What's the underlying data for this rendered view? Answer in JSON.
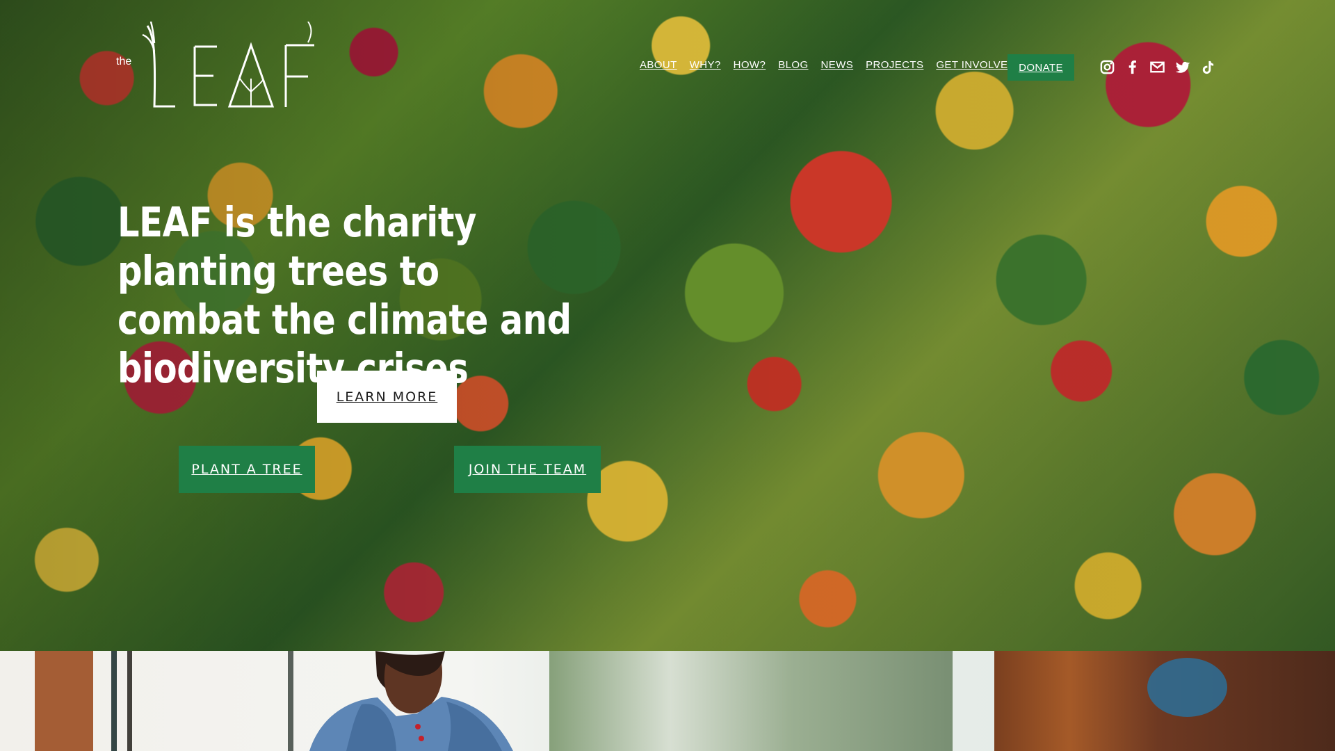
{
  "site": {
    "logo": {
      "prefix": "the",
      "word": "LEAF"
    }
  },
  "navigation": {
    "items": [
      {
        "label": "ABOUT"
      },
      {
        "label": "WHY?"
      },
      {
        "label": "HOW?"
      },
      {
        "label": "BLOG"
      },
      {
        "label": "NEWS"
      },
      {
        "label": "PROJECTS"
      },
      {
        "label": "GET INVOLVED"
      }
    ],
    "donate_label": "DONATE"
  },
  "social": [
    {
      "icon": "instagram-icon"
    },
    {
      "icon": "facebook-icon"
    },
    {
      "icon": "email-icon"
    },
    {
      "icon": "twitter-icon"
    },
    {
      "icon": "tiktok-icon"
    }
  ],
  "hero": {
    "headline": "LEAF is the charity planting trees to combat the climate and biodiversity crises",
    "learn_more": "LEARN MORE",
    "plant_tree": "PLANT A TREE",
    "join_team": "JOIN THE TEAM"
  },
  "colors": {
    "accent": "#1f7f46",
    "button_text": "#ffffff"
  }
}
